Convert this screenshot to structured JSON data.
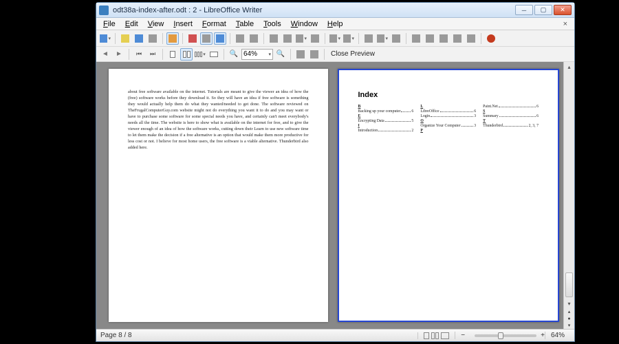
{
  "window": {
    "title": "odt38a-index-after.odt : 2 - LibreOffice Writer"
  },
  "menubar": [
    {
      "u": "F",
      "r": "ile"
    },
    {
      "u": "E",
      "r": "dit"
    },
    {
      "u": "V",
      "r": "iew"
    },
    {
      "u": "I",
      "r": "nsert"
    },
    {
      "u": "F",
      "r": "ormat"
    },
    {
      "u": "T",
      "r": "able"
    },
    {
      "u": "T",
      "r": "ools"
    },
    {
      "u": "W",
      "r": "indow"
    },
    {
      "u": "H",
      "r": "elp"
    }
  ],
  "preview": {
    "zoom": "64%",
    "close_label": "Close Preview"
  },
  "status": {
    "page": "Page 8 / 8",
    "zoom": "64%"
  },
  "pages": {
    "left": {
      "text": "about free software available on the internet. Tutorials are meant to give the viewer an idea of how the (free) software works before they download it. So they will have an idea if free software is something they would actually help them do what they wanted/needed to get done. The software reviewed on TheFrugalComputerGuy.com website might not do everything you want it to do and you may want or have to purchase some software for some special needs you have, and certainly can't meet everybody's needs all the time. The website is here to show what is available on the internet for free, and to give the viewer enough of an idea of how the software works, cutting down their Learn to use new software time to let them make the decision if a free alternative is an option that would make them more productive for less cost or not. I believe for most home users, the free software is a viable alternative. Thunderbird also added here."
    },
    "right": {
      "index": {
        "title": "Index",
        "columns": [
          [
            {
              "head": "B"
            },
            {
              "t": "Backing up your computer",
              "p": "6"
            },
            {
              "head": "E"
            },
            {
              "t": "Encrypting Data",
              "p": "5"
            },
            {
              "head": "I"
            },
            {
              "t": "Introduction",
              "p": "2"
            }
          ],
          [
            {
              "head": "L"
            },
            {
              "t": "LibreOffice",
              "p": "6"
            },
            {
              "t": "Login",
              "p": "3"
            },
            {
              "head": "O"
            },
            {
              "t": "Organize Your Computer",
              "p": "3"
            },
            {
              "head": "P"
            }
          ],
          [
            {
              "t": "Paint.Net",
              "p": "6"
            },
            {
              "head": "S"
            },
            {
              "t": "Summary",
              "p": "6"
            },
            {
              "head": "T"
            },
            {
              "t": "Thunderbird",
              "p": "2, 3, 7"
            }
          ]
        ]
      }
    }
  }
}
